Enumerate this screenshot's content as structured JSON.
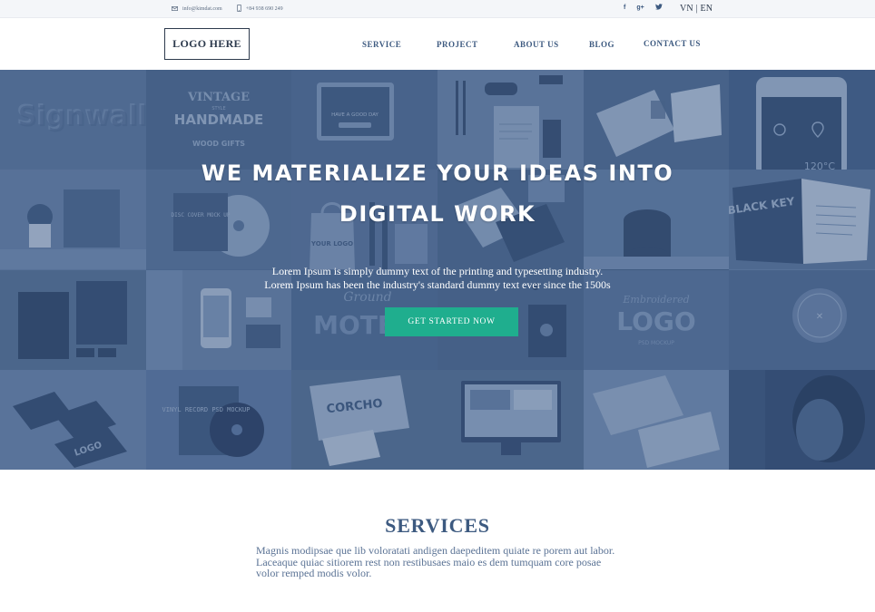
{
  "topbar": {
    "email": "info@kimdat.com",
    "phone": "+84 938 690 249",
    "social_icons": [
      "facebook-icon",
      "google-plus-icon",
      "twitter-icon"
    ],
    "social_glyphs": [
      "f",
      "g+",
      "t"
    ],
    "lang_vn": "VN",
    "lang_sep": "|",
    "lang_en": "EN"
  },
  "header": {
    "logo_text": "LOGO HERE",
    "nav": [
      {
        "label": "SERVICE"
      },
      {
        "label": "PROJECT"
      },
      {
        "label": "ABOUT US"
      },
      {
        "label": "BLOG"
      },
      {
        "label": "CONTACT US"
      }
    ]
  },
  "hero": {
    "title_line1": "WE MATERIALIZE YOUR IDEAS INTO",
    "title_line2": "DIGITAL WORK",
    "subtitle_line1": "Lorem Ipsum is simply dummy text of the printing and typesetting industry.",
    "subtitle_line2": "Lorem Ipsum has been the industry's standard dummy text ever since the 1500s",
    "cta_label": "GET STARTED NOW",
    "cta_color": "#1fae8e",
    "overlay_color": "#3e5c87",
    "tile_texts": {
      "signwall": "Signwall",
      "vintage": "VINTAGE",
      "style": "STYLE",
      "handmade": "HANDMADE",
      "wood_gifts": "WOOD GIFTS",
      "tablet_msg": "HAVE A GOOD DAY",
      "temp": "120°C",
      "black_key": "BLACK KEY",
      "disc_text": "DISC COVER MOCK UP",
      "your_logo": "YOUR LOGO",
      "motel": "MOTEL",
      "embroidered": "Embroidered",
      "logo_big": "LOGO",
      "psd_mockup": "PSD MOCKUP",
      "vinyl": "VINYL RECORD PSD MOCKUP",
      "corcho": "CORCHO",
      "logo_cards": "LOGO"
    }
  },
  "services": {
    "title": "SERVICES",
    "text": "Magnis modipsae que lib voloratati andigen daepeditem quiate re porem aut labor. Laceaque quiac sitiorem rest non restibusaes maio es dem tumquam core posae volor remped modis volor."
  }
}
